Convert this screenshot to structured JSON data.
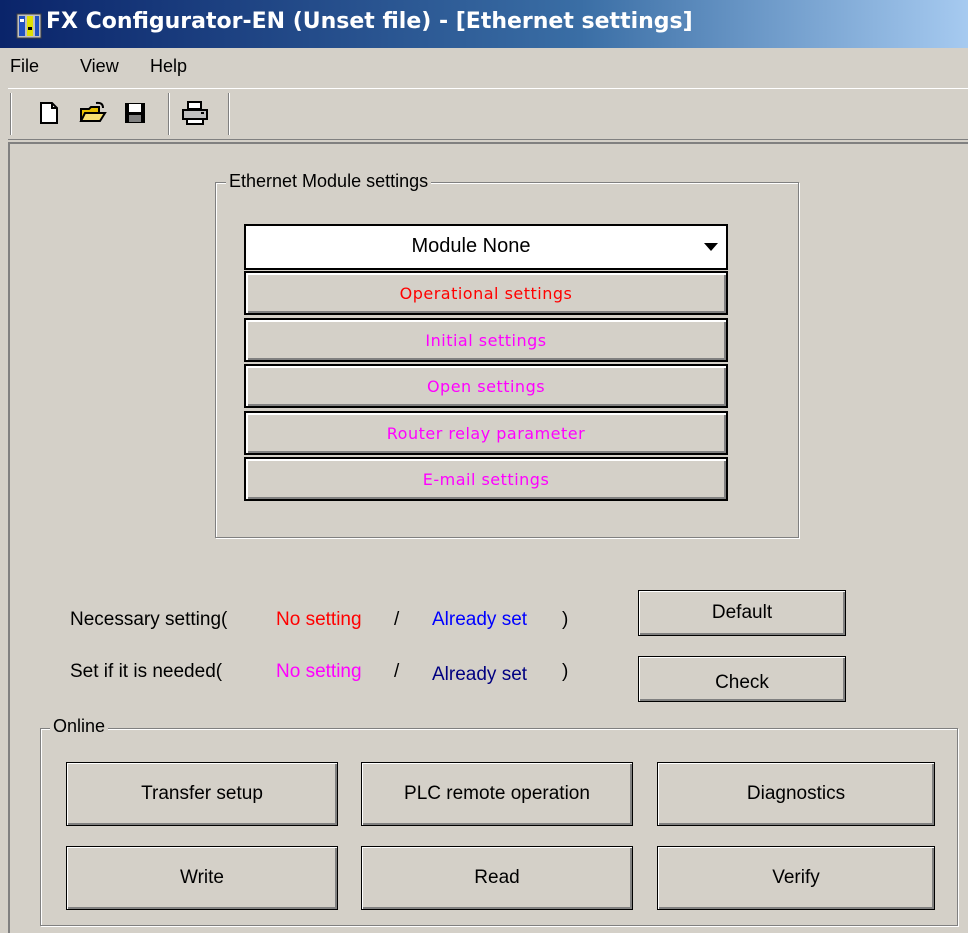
{
  "window": {
    "title": "FX Configurator-EN (Unset file) - [Ethernet settings]"
  },
  "menu": {
    "items": [
      "File",
      "View",
      "Help"
    ]
  },
  "toolbar": {
    "buttons": [
      "new-file-icon",
      "open-folder-icon",
      "save-disk-icon",
      "print-icon"
    ]
  },
  "module_group": {
    "label": "Ethernet Module settings",
    "module_select": {
      "selected": "Module None"
    },
    "settings": [
      {
        "label": "Operational settings",
        "color": "#ff0000"
      },
      {
        "label": "Initial settings",
        "color": "#ff00ff"
      },
      {
        "label": "Open settings",
        "color": "#ff00ff"
      },
      {
        "label": "Router relay parameter",
        "color": "#ff00ff"
      },
      {
        "label": "E-mail settings",
        "color": "#ff00ff"
      }
    ]
  },
  "legend": {
    "necessary": {
      "prefix": "Necessary setting(",
      "no_setting": "No setting",
      "slash": "/",
      "already_set": "Already set",
      "suffix": ")"
    },
    "optional": {
      "prefix": "Set if it is needed(",
      "no_setting": "No setting",
      "slash": "/",
      "already_set": "Already set",
      "suffix": ")"
    },
    "colors": {
      "necessary_no_setting": "#ff0000",
      "optional_no_setting": "#ff00ff",
      "already_set": "#0000ff",
      "already_set_optional": "#000080"
    }
  },
  "buttons": {
    "default": "Default",
    "check": "Check"
  },
  "online_group": {
    "label": "Online",
    "transfer_setup": "Transfer setup",
    "plc_remote_operation": "PLC remote operation",
    "diagnostics": "Diagnostics",
    "write": "Write",
    "read": "Read",
    "verify": "Verify"
  }
}
